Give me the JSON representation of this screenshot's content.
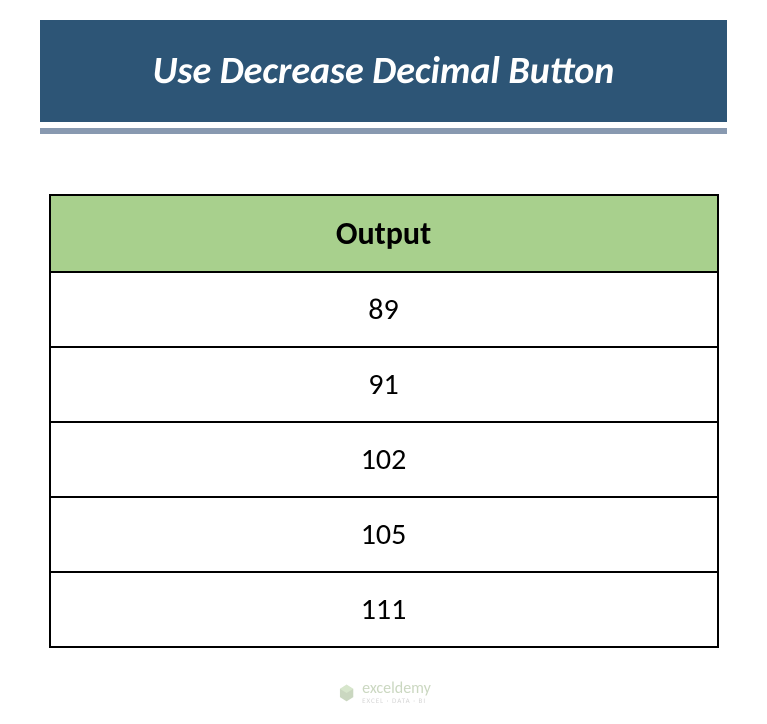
{
  "title": "Use Decrease Decimal Button",
  "chart_data": {
    "type": "table",
    "columns": [
      "Output"
    ],
    "rows": [
      [
        89
      ],
      [
        91
      ],
      [
        102
      ],
      [
        105
      ],
      [
        111
      ]
    ]
  },
  "watermark": {
    "brand": "exceldemy",
    "tagline": "EXCEL · DATA · BI"
  }
}
